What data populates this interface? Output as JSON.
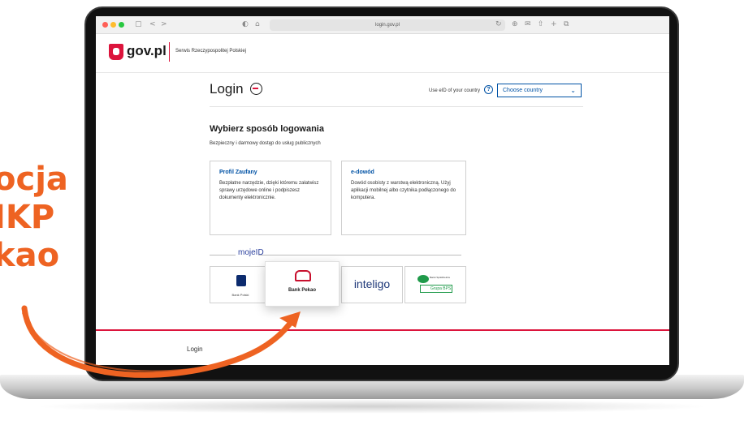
{
  "promo": {
    "lines": [
      "ocja",
      "IKP",
      "kao"
    ],
    "color": "#ee6322"
  },
  "browser": {
    "url": "login.gov.pl",
    "controls": {
      "back": "<",
      "forward": ">",
      "sidebar": "▢",
      "shield": "◐",
      "home": "⌂",
      "reload": "↻",
      "download": "⊕",
      "mail": "✉",
      "share": "⇧",
      "new_tab": "+",
      "tabs": "⧉"
    }
  },
  "header": {
    "logo": "gov.pl",
    "service": "Serwis Rzeczypospolitej Polskiej",
    "brand_color": "#dc143c"
  },
  "login": {
    "title": "Login",
    "eid_label": "Use eID of your country",
    "help": "?",
    "country_select": {
      "value": "Choose country",
      "chevron": "⌄"
    }
  },
  "methods": {
    "heading": "Wybierz sposób logowania",
    "subheading": "Bezpieczny i darmowy dostęp do usług publicznych",
    "cards": [
      {
        "title": "Profil Zaufany",
        "text": "Bezpłatne narzędzie, dzięki któremu załatwisz sprawy urzędowe online i podpiszesz dokumenty elektronicznie."
      },
      {
        "title": "e-dowód",
        "text": "Dowód osobisty z warstwą elektroniczną. Użyj aplikacji mobilnej albo czytnika podłączonego do komputera."
      }
    ]
  },
  "mojeid": {
    "label": "mojeID",
    "banks": [
      {
        "name": "Bank Polski"
      },
      {
        "name": "Bank Pekao"
      },
      {
        "name": "inteligo"
      },
      {
        "name": "Banki Spółdzielcze",
        "group": "Grupa BPS"
      }
    ]
  },
  "footer": {
    "login_link": "Login"
  },
  "colors": {
    "accent_blue": "#0052a5",
    "promo_orange": "#ee6322"
  }
}
